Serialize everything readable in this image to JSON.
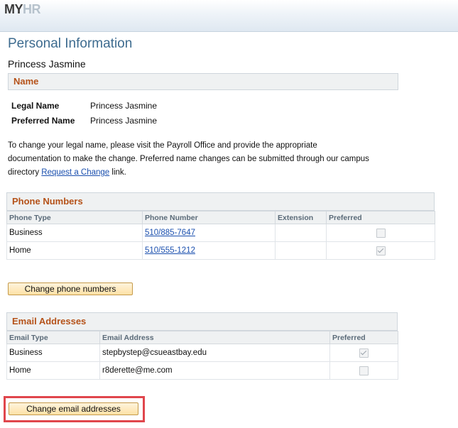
{
  "logo": {
    "part1": "MY",
    "part2": "HR"
  },
  "page_title": "Personal Information",
  "person_name": "Princess Jasmine",
  "name_section": {
    "header": "Name",
    "legal_label": "Legal Name",
    "legal_value": "Princess Jasmine",
    "preferred_label": "Preferred Name",
    "preferred_value": "Princess Jasmine"
  },
  "info": {
    "text_before": "To change your legal name, please visit the Payroll Office and provide the appropriate documentation to make the change. Preferred name changes can be submitted through our campus directory ",
    "link": "Request a Change",
    "text_after": " link."
  },
  "phones": {
    "header": "Phone Numbers",
    "columns": [
      "Phone Type",
      "Phone Number",
      "Extension",
      "Preferred"
    ],
    "rows": [
      {
        "type": "Business",
        "number": "510/885-7647",
        "extension": "",
        "preferred": false
      },
      {
        "type": "Home",
        "number": "510/555-1212",
        "extension": "",
        "preferred": true
      }
    ],
    "button": "Change phone numbers"
  },
  "emails": {
    "header": "Email Addresses",
    "columns": [
      "Email Type",
      "Email Address",
      "Preferred"
    ],
    "rows": [
      {
        "type": "Business",
        "address": "stepbystep@csueastbay.edu",
        "preferred": true
      },
      {
        "type": "Home",
        "address": "r8derette@me.com",
        "preferred": false
      }
    ],
    "button": "Change email addresses"
  },
  "colors": {
    "accent_orange": "#b55219",
    "title_blue": "#3d6b8f",
    "highlight_red": "#e0464c",
    "link_blue": "#1a4fae"
  }
}
